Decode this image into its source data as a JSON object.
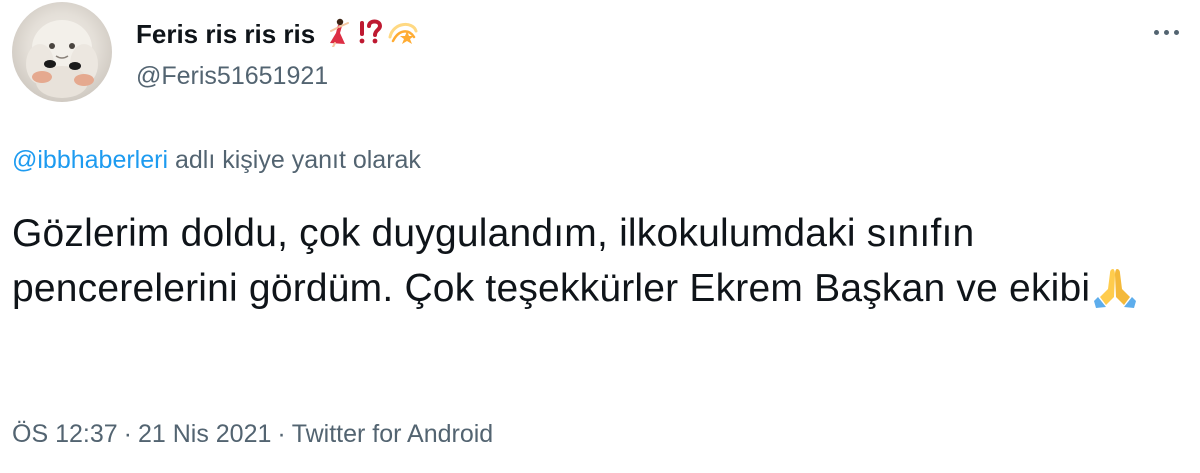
{
  "author": {
    "display_name": "Feris ris ris ris",
    "name_emojis": [
      "dancer-icon",
      "exclamation-question-icon",
      "dizzy-star-icon"
    ],
    "handle": "@Feris51651921",
    "avatar": "plush-doll-avatar"
  },
  "more_menu": {
    "icon": "more-horizontal-icon"
  },
  "reply": {
    "mention": "@ibbhaberleri",
    "suffix": " adlı kişiye yanıt olarak"
  },
  "tweet": {
    "text": "Gözlerim doldu, çok duygulandım, ilkokulumdaki sınıfın pencerelerini gördüm. Çok teşekkürler Ekrem Başkan ve ekibi",
    "trailing_emoji": "folded-hands-icon"
  },
  "meta": {
    "time": "ÖS 12:37",
    "separator": "·",
    "date": "21 Nis 2021",
    "source": "Twitter for Android"
  },
  "colors": {
    "text_primary": "#0f1419",
    "text_secondary": "#536471",
    "link": "#1d9bf0"
  }
}
